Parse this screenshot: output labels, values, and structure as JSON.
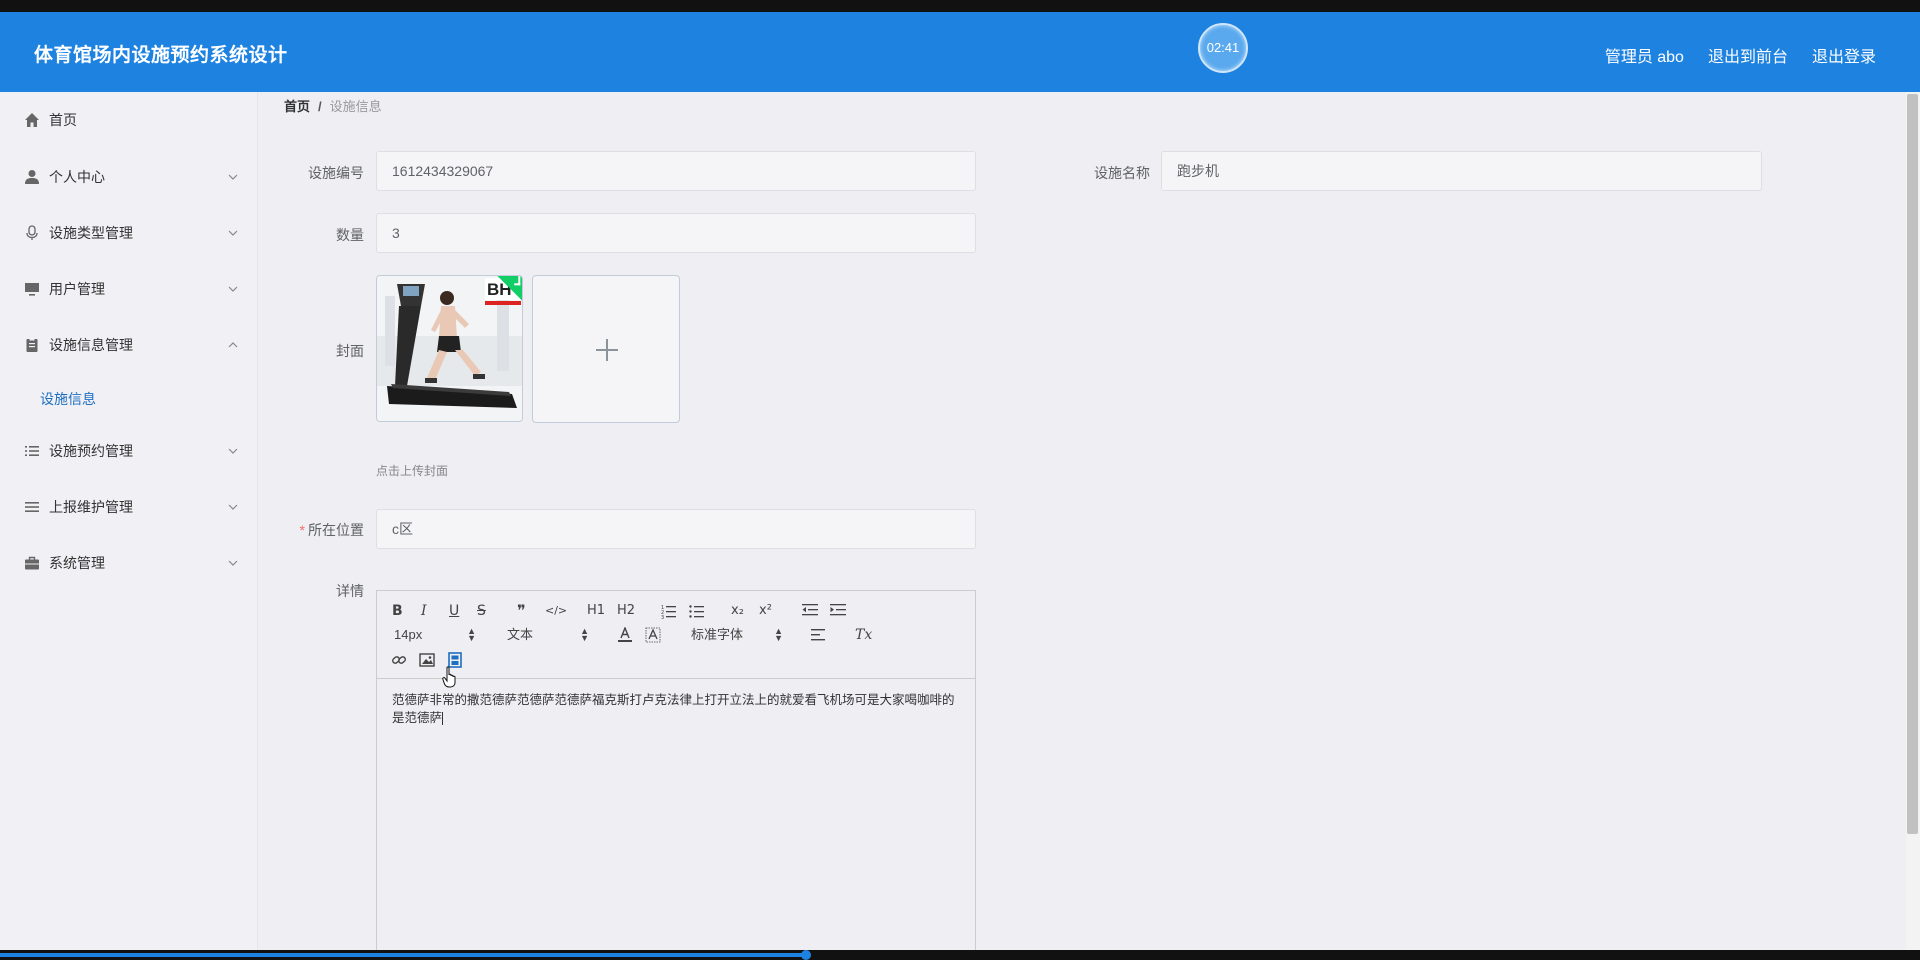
{
  "header": {
    "title": "体育馆场内设施预约系统设计",
    "clock": "02:41",
    "links": [
      "管理员 abo",
      "退出到前台",
      "退出登录"
    ]
  },
  "sidebar": {
    "items": [
      {
        "label": "首页",
        "icon": "home-icon"
      },
      {
        "label": "个人中心",
        "icon": "user-icon"
      },
      {
        "label": "设施类型管理",
        "icon": "microphone-icon"
      },
      {
        "label": "用户管理",
        "icon": "monitor-icon"
      },
      {
        "label": "设施信息管理",
        "icon": "clipboard-icon"
      },
      {
        "label": "设施预约管理",
        "icon": "list-icon"
      },
      {
        "label": "上报维护管理",
        "icon": "list-icon"
      },
      {
        "label": "系统管理",
        "icon": "briefcase-icon"
      }
    ],
    "sub_item": "设施信息"
  },
  "breadcrumb": {
    "home": "首页",
    "separator": "/",
    "current": "设施信息"
  },
  "form": {
    "code_label": "设施编号",
    "code_value": "1612434329067",
    "name_label": "设施名称",
    "name_value": "跑步机",
    "qty_label": "数量",
    "qty_value": "3",
    "cover_label": "封面",
    "cover_tip": "点击上传封面",
    "location_required": "*",
    "location_label": "所在位置",
    "location_value": "c区",
    "detail_label": "详情"
  },
  "editor": {
    "font_size": "14px",
    "text_type": "文本",
    "font_family": "标准字体",
    "content": "范德萨非常的撒范德萨范德萨范德萨福克斯打卢克法律上打开立法上的就爱看飞机场可是大家喝咖啡的是范德萨",
    "toolbar_glyphs": {
      "bold": "B",
      "italic": "I",
      "underline": "U",
      "strike": "S",
      "blockquote": "❞",
      "code": "</>",
      "h1": "H1",
      "h2": "H2",
      "subscript": "x₂",
      "superscript": "x²",
      "clean": "Tx"
    }
  },
  "colors": {
    "header": "#1e82e0",
    "active_sub": "#1e6fc0",
    "required": "#f56c6c"
  },
  "video_progress": 0.42
}
